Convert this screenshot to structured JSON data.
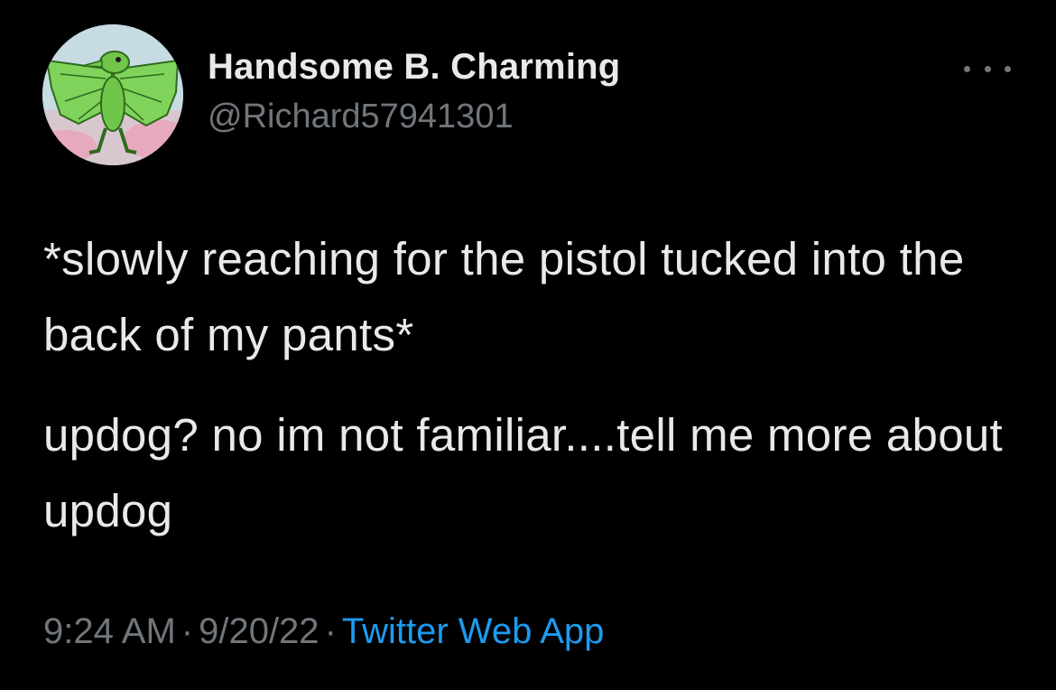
{
  "author": {
    "display_name": "Handsome B. Charming",
    "handle": "@Richard57941301",
    "avatar_icon": "cartoon-pterodactyl-avatar"
  },
  "tweet": {
    "paragraphs": [
      "*slowly reaching for the pistol tucked into the back of my pants*",
      "updog? no im not familiar....tell me more about updog"
    ],
    "time": "9:24 AM",
    "date": "9/20/22",
    "source": "Twitter Web App",
    "separator": "·"
  },
  "menu": {
    "more_icon": "more-horizontal-icon"
  },
  "colors": {
    "background": "#000000",
    "primary_text": "#e7e9ea",
    "secondary_text": "#71767b",
    "link": "#1d9bf0"
  }
}
